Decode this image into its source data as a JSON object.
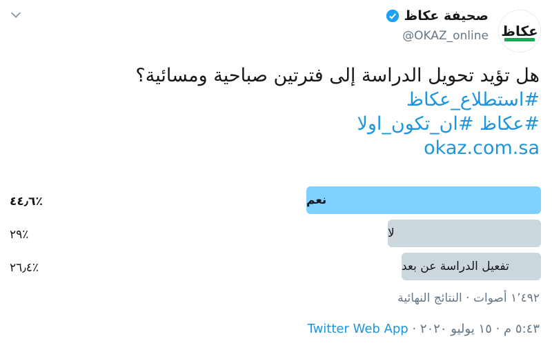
{
  "account": {
    "logo_text": "عكاظ",
    "name": "صحيفة عكاظ",
    "handle": "@OKAZ_online",
    "verified": true
  },
  "tweet": {
    "question": "هل تؤيد تحويل الدراسة إلى فترتين صباحية ومسائية؟",
    "hashtag1": "#استطلاع_عكاظ",
    "hashtag2a": "#عكاظ",
    "hashtag2b": "#ان_تكون_اولا",
    "link": "okaz.com.sa"
  },
  "poll": {
    "options": [
      {
        "label": "نعم",
        "percent_text": "٪٤٤٫٦",
        "percent": 44.6,
        "winner": true
      },
      {
        "label": "لا",
        "percent_text": "٪٢٩",
        "percent": 29,
        "winner": false
      },
      {
        "label": "تفعيل الدراسة عن بعد",
        "percent_text": "٪٢٦٫٤",
        "percent": 26.4,
        "winner": false
      }
    ],
    "summary": "١٬٤٩٢ أصوات · النتائج النهائية"
  },
  "meta": {
    "time_date": "٥:٤٣ م · ١٥ يوليو ٢٠٢٠ · ",
    "app": "Twitter Web App"
  },
  "colors": {
    "accent": "#1b95e0",
    "winner_bar": "#7ed0ff",
    "other_bar": "#ccd6dd",
    "verified_badge": "#1da1f2",
    "logo_bar": "#18a556"
  },
  "icons": {
    "menu": "chevron-down-icon",
    "verified": "verified-badge-icon"
  }
}
